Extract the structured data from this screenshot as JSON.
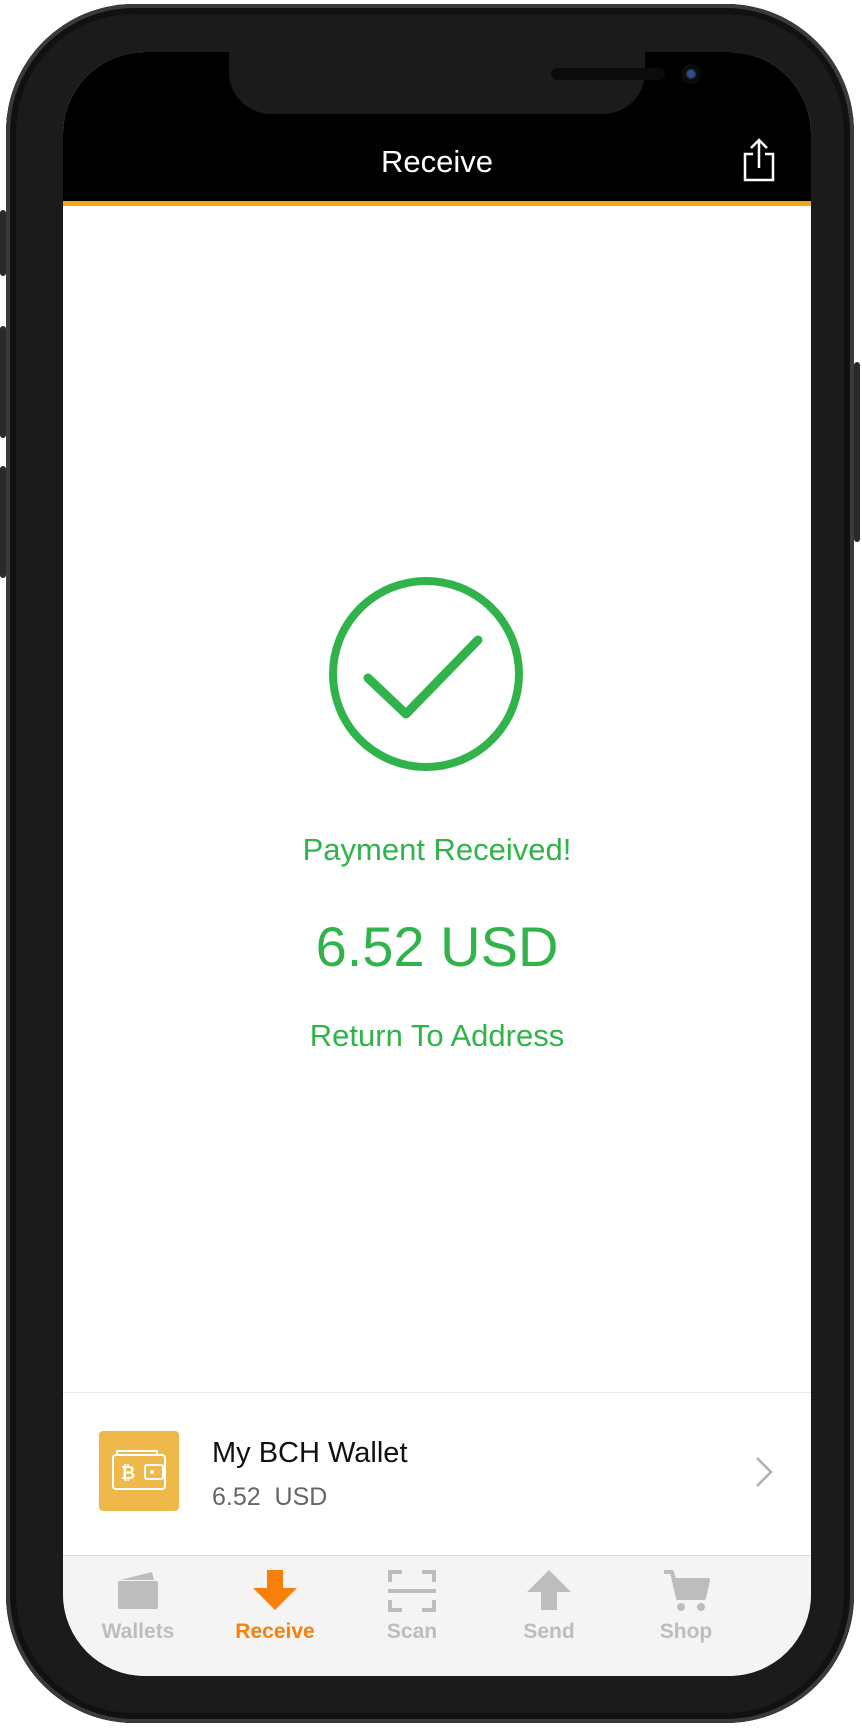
{
  "header": {
    "title": "Receive",
    "share_icon": "share-icon",
    "accent_color": "#f0a81a"
  },
  "success": {
    "icon": "checkmark-circle-icon",
    "message": "Payment Received!",
    "amount": "6.52 USD",
    "return_link": "Return To Address",
    "color": "#2fb34a"
  },
  "wallet": {
    "name": "My BCH Wallet",
    "balance": "6.52  USD",
    "icon": "bch-wallet-icon",
    "icon_color": "#efb84a"
  },
  "tabs": [
    {
      "label": "Wallets",
      "icon": "wallet-icon",
      "active": false
    },
    {
      "label": "Receive",
      "icon": "arrow-down-icon",
      "active": true
    },
    {
      "label": "Scan",
      "icon": "scan-icon",
      "active": false
    },
    {
      "label": "Send",
      "icon": "arrow-up-icon",
      "active": false
    },
    {
      "label": "Shop",
      "icon": "cart-icon",
      "active": false
    }
  ],
  "colors": {
    "active_tab": "#f7800a",
    "inactive_tab": "#bdbdbd"
  }
}
